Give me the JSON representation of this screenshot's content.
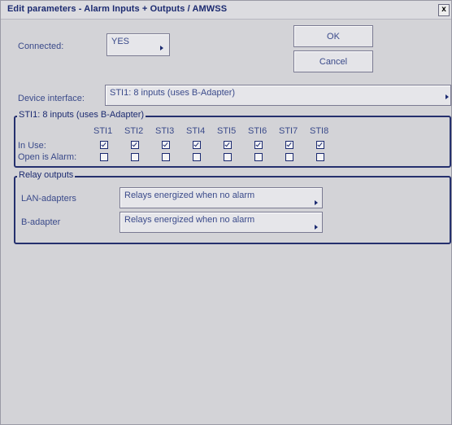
{
  "window": {
    "title": "Edit parameters - Alarm Inputs + Outputs / AMWSS",
    "close": "x"
  },
  "connected": {
    "label": "Connected:",
    "value": "YES"
  },
  "buttons": {
    "ok": "OK",
    "cancel": "Cancel"
  },
  "device_interface": {
    "label": "Device interface:",
    "value": "STI1: 8 inputs (uses B-Adapter)"
  },
  "sti_group": {
    "title": "STI1: 8 inputs (uses B-Adapter)",
    "columns": [
      "STI1",
      "STI2",
      "STI3",
      "STI4",
      "STI5",
      "STI6",
      "STI7",
      "STI8"
    ],
    "in_use_label": "In Use:",
    "open_alarm_label": "Open is Alarm:",
    "in_use": [
      true,
      true,
      true,
      true,
      true,
      true,
      true,
      true
    ],
    "open_is_alarm": [
      false,
      false,
      false,
      false,
      false,
      false,
      false,
      false
    ]
  },
  "relay_group": {
    "title": "Relay outputs",
    "lan_label": "LAN-adapters",
    "lan_value": "Relays energized when no alarm",
    "b_label": "B-adapter",
    "b_value": "Relays energized when no alarm"
  }
}
